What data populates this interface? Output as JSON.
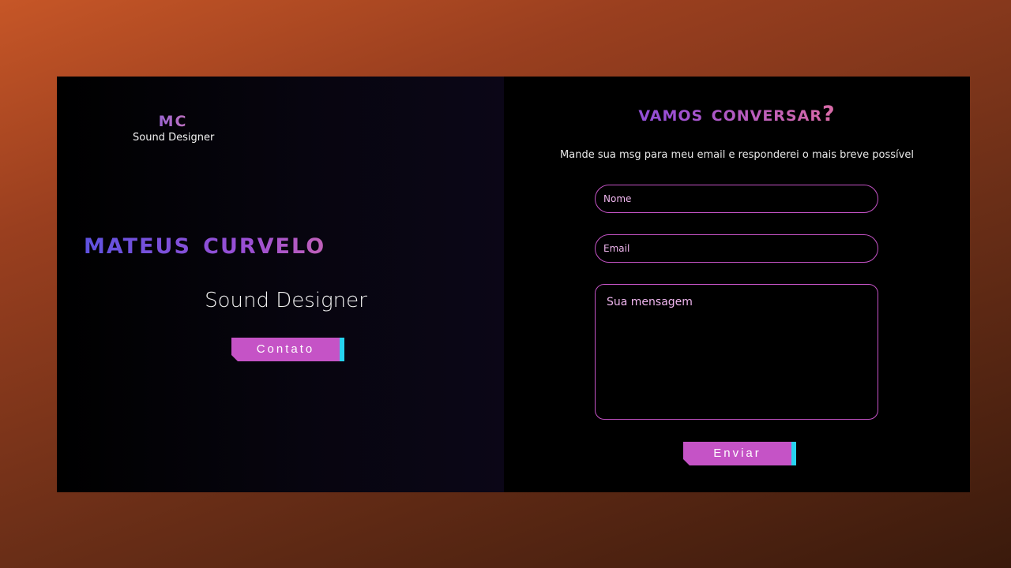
{
  "logo": {
    "mark": "MC",
    "subtitle": "Sound Designer"
  },
  "hero": {
    "name": "Mateus Curvelo",
    "role": "Sound Designer",
    "cta_label": "Contato"
  },
  "contact": {
    "title": "vamos conversar?",
    "subtitle": "Mande sua msg para meu email e responderei o mais breve possível",
    "name_placeholder": "Nome",
    "email_placeholder": "Email",
    "message_placeholder": "Sua mensagem",
    "submit_label": "Enviar"
  },
  "colors": {
    "button": "#c553c6",
    "button_accent": "#27d3f0",
    "field_border": "#c553c6",
    "gradient_start": "#5f52e0",
    "gradient_end": "#f2b26c"
  }
}
